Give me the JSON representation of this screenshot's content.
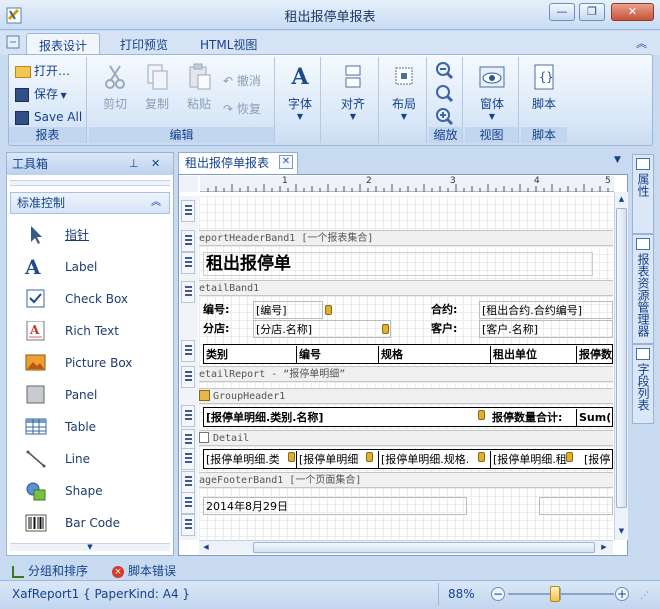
{
  "window": {
    "title": "租出报停单报表",
    "min": "—",
    "restore": "❐",
    "close": "✕"
  },
  "ribbon_tabs": [
    "报表设计",
    "打印预览",
    "HTML视图"
  ],
  "ribbon": {
    "report_group": {
      "open": "打开…",
      "save": "保存",
      "save_all": "Save All",
      "title": "报表"
    },
    "edit_group": {
      "cut": "剪切",
      "copy": "复制",
      "paste": "粘贴",
      "undo": "撤消",
      "redo": "恢复",
      "title": "编辑"
    },
    "font": "字体",
    "align": "对齐",
    "layout": "布局",
    "zoom_group": {
      "title": "缩放"
    },
    "view_group": {
      "window": "窗体",
      "title": "视图"
    },
    "script_group": {
      "script": "脚本",
      "title": "脚本"
    }
  },
  "toolbox": {
    "title": "工具箱",
    "category": "标准控制",
    "items": [
      "指针",
      "Label",
      "Check Box",
      "Rich Text",
      "Picture Box",
      "Panel",
      "Table",
      "Line",
      "Shape",
      "Bar Code"
    ]
  },
  "document": {
    "tab": "租出报停单报表",
    "ruler_marks": [
      "1",
      "2",
      "3",
      "4",
      "5"
    ],
    "bands": {
      "report_header": "eportHeaderBand1 [一个报表集合]",
      "detail": "etailBand1",
      "detail_report": "etailReport - “报停单明细”",
      "group_header": "GroupHeader1",
      "detail2": "Detail",
      "page_footer": "ageFooterBand1 [一个页面集合]"
    },
    "report_title": "租出报停单",
    "fields": {
      "bianhao_label": "编号:",
      "bianhao_value": "[编号]",
      "heyue_label": "合约:",
      "heyue_value": "[租出合约.合约编号]",
      "fendian_label": "分店:",
      "fendian_value": "[分店.名称]",
      "kehu_label": "客户:",
      "kehu_value": "[客户.名称]"
    },
    "table_headers": [
      "类别",
      "编号",
      "规格",
      "租出单位",
      "报停数"
    ],
    "group_row": {
      "category": "[报停单明细.类别.名称]",
      "sum_label": "报停数量合计:",
      "sum_value": "Sum(["
    },
    "detail_row": [
      "[报停单明细.类",
      "[报停单明细",
      "[报停单明细.规格.",
      "[报停单明细.租",
      "[报停"
    ],
    "footer_date": "2014年8月29日"
  },
  "right_tabs": [
    "属性",
    "报表资源管理器",
    "字段列表"
  ],
  "bottom_tabs": [
    "分组和排序",
    "脚本错误"
  ],
  "status": {
    "left": "XafReport1 { PaperKind: A4 }",
    "zoom": "88%",
    "zoom_level": 0.44
  },
  "colors": {
    "accent": "#15428b",
    "ribbon_bg": "#dae8f8",
    "frame": "#c7daf0"
  }
}
